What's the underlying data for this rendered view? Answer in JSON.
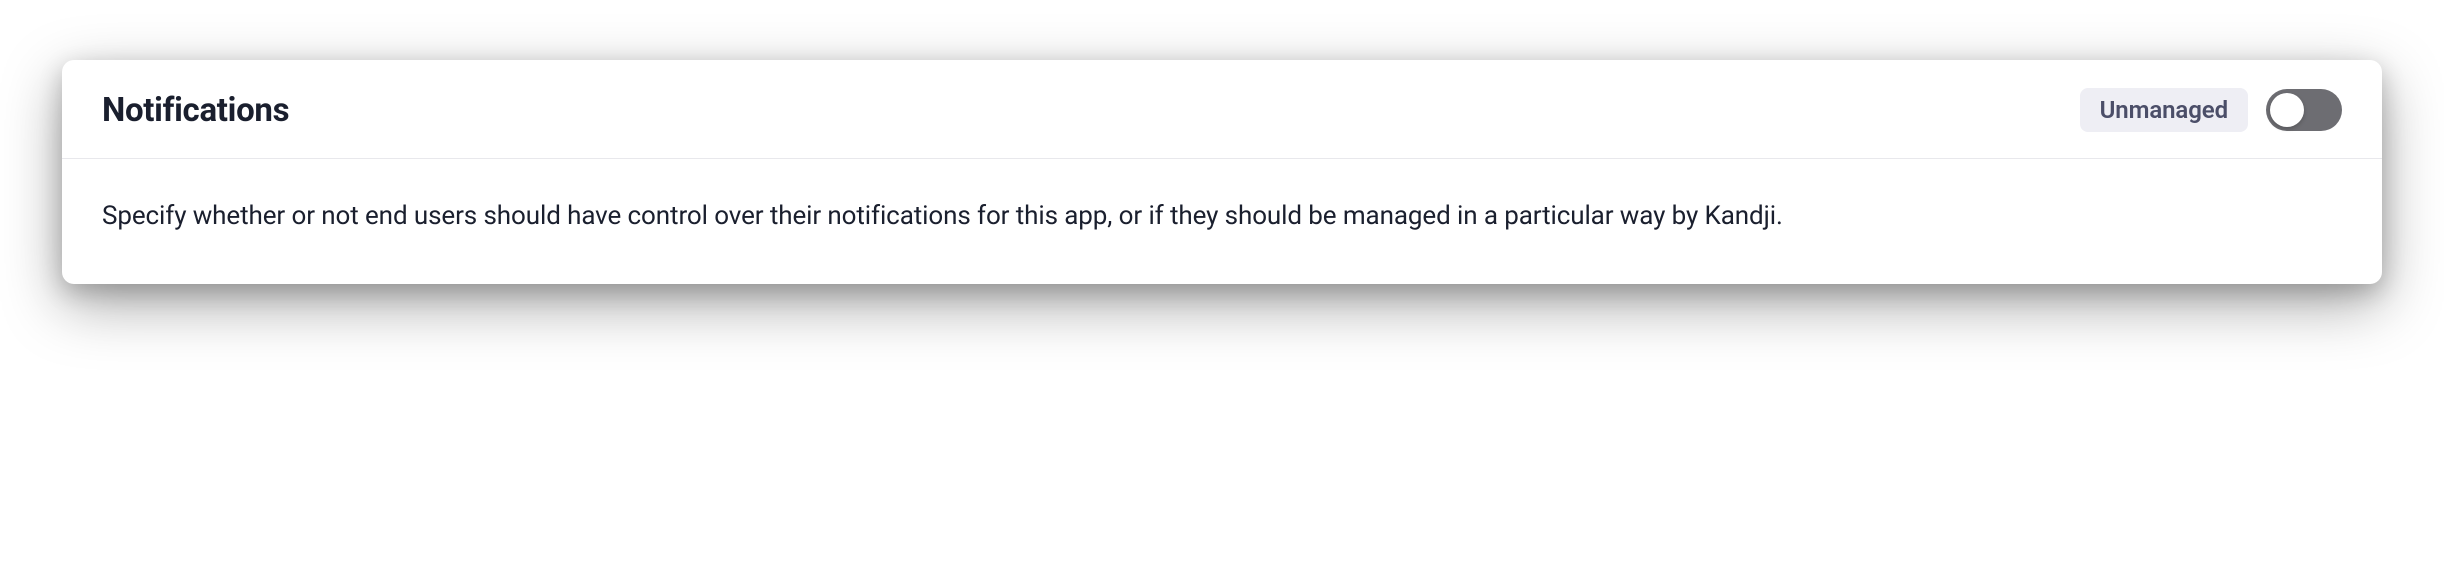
{
  "card": {
    "title": "Notifications",
    "status_badge": "Unmanaged",
    "toggle_state": "off",
    "description": "Specify whether or not end users should have control over their notifications for this app, or if they should be managed in a particular way by Kandji."
  }
}
